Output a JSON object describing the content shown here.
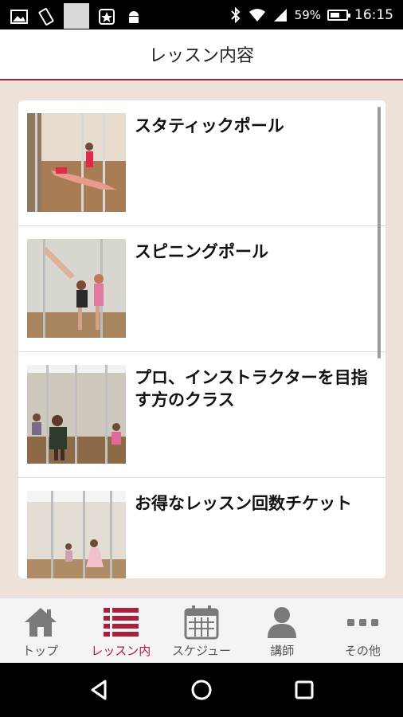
{
  "status_bar": {
    "battery_percent": "59%",
    "time": "16:15"
  },
  "header": {
    "title": "レッスン内容"
  },
  "lessons": [
    {
      "title": "スタティックポール"
    },
    {
      "title": "スピニングポール"
    },
    {
      "title": "プロ、インストラクターを目指す方のクラス"
    },
    {
      "title": "お得なレッスン回数チケット"
    }
  ],
  "tabs": [
    {
      "label": "トップ",
      "icon": "home-icon",
      "active": false
    },
    {
      "label": "レッスン内",
      "icon": "list-icon",
      "active": true
    },
    {
      "label": "スケジュー",
      "icon": "calendar-icon",
      "active": false
    },
    {
      "label": "講師",
      "icon": "person-icon",
      "active": false
    },
    {
      "label": "その他",
      "icon": "more-icon",
      "active": false
    }
  ],
  "colors": {
    "accent": "#a8203c",
    "background": "#ece2d8",
    "inactive_icon": "#7a7a7a"
  }
}
